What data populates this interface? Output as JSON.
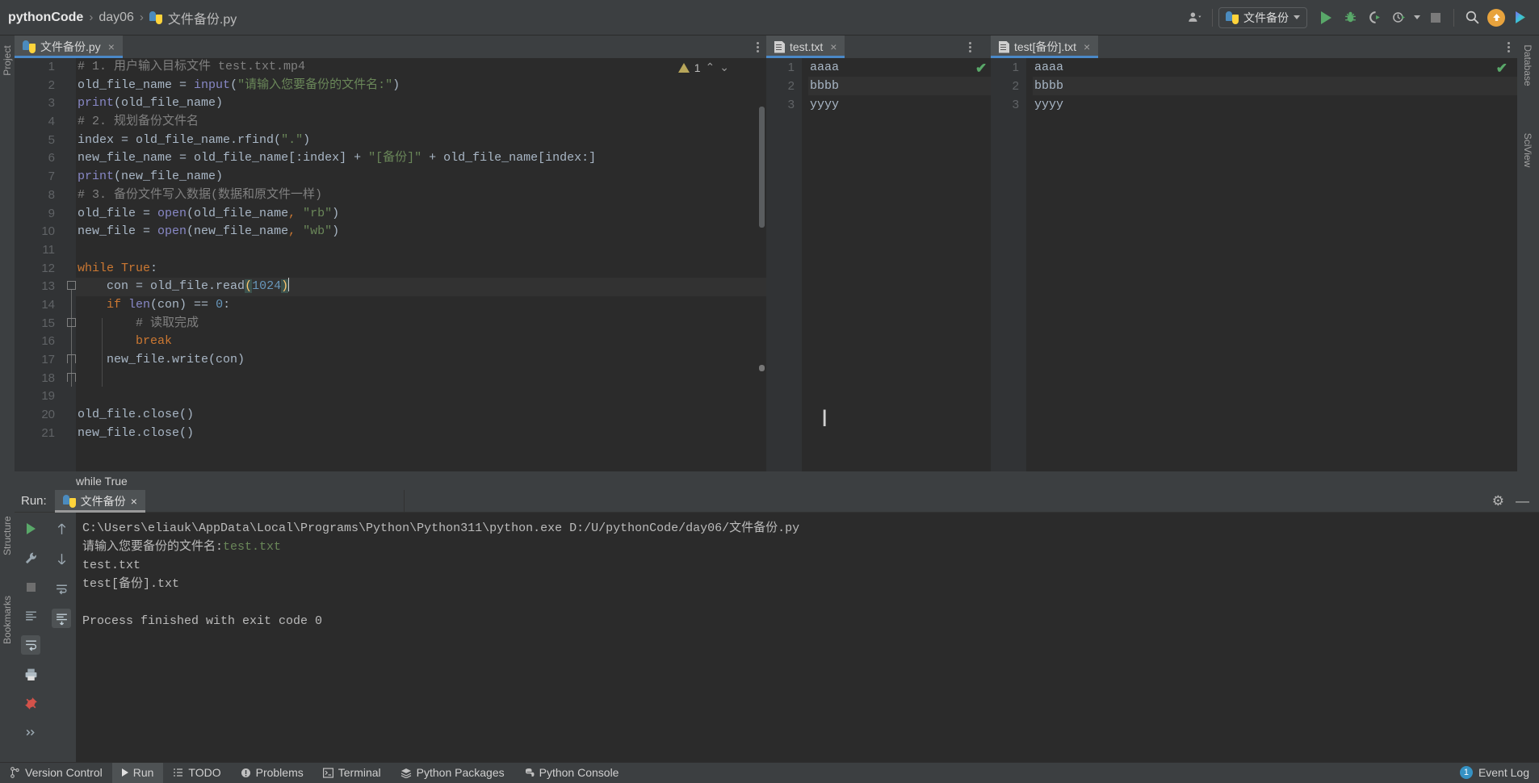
{
  "topbar": {
    "breadcrumbs": [
      {
        "label": "pythonCode",
        "icon": null
      },
      {
        "label": "day06",
        "icon": null
      },
      {
        "label": "文件备份.py",
        "icon": "python-file-icon"
      }
    ],
    "separator": "›",
    "account_icon": "account-icon",
    "run_config": {
      "label": "文件备份",
      "icon": "python-file-icon",
      "dropdown": "▾"
    },
    "actions": [
      {
        "name": "run-button",
        "icon": "play-icon",
        "label": "Run"
      },
      {
        "name": "debug-button",
        "icon": "bug-icon",
        "label": "Debug"
      },
      {
        "name": "run-with-coverage-button",
        "icon": "coverage-icon",
        "label": "Run with Coverage"
      },
      {
        "name": "profile-button",
        "icon": "profiler-icon",
        "label": "Profile"
      },
      {
        "name": "stop-button",
        "icon": "stop-icon",
        "label": "Stop"
      },
      {
        "name": "search-everywhere-button",
        "icon": "search-icon",
        "label": "Search Everywhere"
      },
      {
        "name": "update-project-button",
        "icon": "arrow-up-circle-icon",
        "label": "Update"
      },
      {
        "name": "ai-assistant-button",
        "icon": "ai-icon",
        "label": "AI Assistant"
      }
    ]
  },
  "editor": {
    "tab": {
      "label": "文件备份.py",
      "icon": "python-file-icon",
      "close": "×"
    },
    "options_icon": "more-options-icon",
    "inspection": {
      "warning_count": "1",
      "warn_icon": "warning-triangle-icon",
      "up": "⌃",
      "down": "⌄"
    },
    "breadcrumb_below": "while True",
    "lines": [
      {
        "n": "1",
        "tokens": [
          {
            "t": "# 1. 用户输入目标文件 test.txt.mp4",
            "c": "c-com"
          }
        ]
      },
      {
        "n": "2",
        "tokens": [
          {
            "t": "old_file_name ",
            "c": "c-var"
          },
          {
            "t": "= ",
            "c": "c-pun"
          },
          {
            "t": "input",
            "c": "c-fn"
          },
          {
            "t": "(",
            "c": "c-pun"
          },
          {
            "t": "\"请输入您要备份的文件名:\"",
            "c": "c-str"
          },
          {
            "t": ")",
            "c": "c-pun"
          }
        ]
      },
      {
        "n": "3",
        "tokens": [
          {
            "t": "print",
            "c": "c-fn"
          },
          {
            "t": "(old_file_name)",
            "c": "c-var"
          }
        ]
      },
      {
        "n": "4",
        "tokens": [
          {
            "t": "# 2. 规划备份文件名",
            "c": "c-com"
          }
        ]
      },
      {
        "n": "5",
        "tokens": [
          {
            "t": "index ",
            "c": "c-var"
          },
          {
            "t": "= ",
            "c": "c-pun"
          },
          {
            "t": "old_file_name.rfind(",
            "c": "c-var"
          },
          {
            "t": "\".\"",
            "c": "c-str"
          },
          {
            "t": ")",
            "c": "c-var"
          }
        ]
      },
      {
        "n": "6",
        "tokens": [
          {
            "t": "new_file_name ",
            "c": "c-var"
          },
          {
            "t": "= ",
            "c": "c-pun"
          },
          {
            "t": "old_file_name[:index] + ",
            "c": "c-var"
          },
          {
            "t": "\"[备份]\"",
            "c": "c-str"
          },
          {
            "t": " + old_file_name[index:]",
            "c": "c-var"
          }
        ]
      },
      {
        "n": "7",
        "tokens": [
          {
            "t": "print",
            "c": "c-fn"
          },
          {
            "t": "(new_file_name)",
            "c": "c-var"
          }
        ]
      },
      {
        "n": "8",
        "tokens": [
          {
            "t": "# 3. 备份文件写入数据(数据和原文件一样)",
            "c": "c-com"
          }
        ]
      },
      {
        "n": "9",
        "tokens": [
          {
            "t": "old_file ",
            "c": "c-var"
          },
          {
            "t": "= ",
            "c": "c-pun"
          },
          {
            "t": "open",
            "c": "c-fn"
          },
          {
            "t": "(old_file_name",
            "c": "c-var"
          },
          {
            "t": ", ",
            "c": "c-kw"
          },
          {
            "t": "\"rb\"",
            "c": "c-str"
          },
          {
            "t": ")",
            "c": "c-var"
          }
        ]
      },
      {
        "n": "10",
        "tokens": [
          {
            "t": "new_file ",
            "c": "c-var"
          },
          {
            "t": "= ",
            "c": "c-pun"
          },
          {
            "t": "open",
            "c": "c-fn"
          },
          {
            "t": "(new_file_name",
            "c": "c-var"
          },
          {
            "t": ", ",
            "c": "c-kw"
          },
          {
            "t": "\"wb\"",
            "c": "c-str"
          },
          {
            "t": ")",
            "c": "c-var"
          }
        ]
      },
      {
        "n": "11",
        "tokens": []
      },
      {
        "n": "12",
        "tokens": [
          {
            "t": "while ",
            "c": "c-kw"
          },
          {
            "t": "True",
            "c": "c-kw"
          },
          {
            "t": ":",
            "c": "c-pun"
          }
        ]
      },
      {
        "n": "13",
        "tokens": [
          {
            "t": "    con ",
            "c": "c-var"
          },
          {
            "t": "= ",
            "c": "c-pun"
          },
          {
            "t": "old_file.read",
            "c": "c-var"
          },
          {
            "t": "(",
            "c": "c-match"
          },
          {
            "t": "1024",
            "c": "c-num"
          },
          {
            "t": ")",
            "c": "c-match"
          }
        ],
        "highlight": true,
        "caret_after": true
      },
      {
        "n": "14",
        "tokens": [
          {
            "t": "    ",
            "c": "c-var"
          },
          {
            "t": "if ",
            "c": "c-kw"
          },
          {
            "t": "len",
            "c": "c-fn"
          },
          {
            "t": "(con) == ",
            "c": "c-var"
          },
          {
            "t": "0",
            "c": "c-num"
          },
          {
            "t": ":",
            "c": "c-pun"
          }
        ]
      },
      {
        "n": "15",
        "tokens": [
          {
            "t": "        # 读取完成",
            "c": "c-com"
          }
        ]
      },
      {
        "n": "16",
        "tokens": [
          {
            "t": "        ",
            "c": "c-var"
          },
          {
            "t": "break",
            "c": "c-kw"
          }
        ]
      },
      {
        "n": "17",
        "tokens": [
          {
            "t": "    new_file.write(con)",
            "c": "c-var"
          }
        ]
      },
      {
        "n": "18",
        "tokens": []
      },
      {
        "n": "19",
        "tokens": []
      },
      {
        "n": "20",
        "tokens": [
          {
            "t": "old_file.close()",
            "c": "c-var"
          }
        ]
      },
      {
        "n": "21",
        "tokens": [
          {
            "t": "new_file.close()",
            "c": "c-var"
          }
        ]
      }
    ]
  },
  "split_b": {
    "tab": {
      "label": "test.txt",
      "icon": "text-file-icon",
      "close": "×"
    },
    "options_icon": "more-options-icon",
    "status_icon": "checkmark-ok-icon",
    "lines": [
      {
        "n": "1",
        "text": "aaaa"
      },
      {
        "n": "2",
        "text": "bbbb"
      },
      {
        "n": "3",
        "text": "yyyy"
      }
    ]
  },
  "split_c": {
    "tab": {
      "label": "test[备份].txt",
      "icon": "text-file-icon",
      "close": "×"
    },
    "options_icon": "more-options-icon",
    "status_icon": "checkmark-ok-icon",
    "lines": [
      {
        "n": "1",
        "text": "aaaa"
      },
      {
        "n": "2",
        "text": "bbbb"
      },
      {
        "n": "3",
        "text": "yyyy"
      }
    ]
  },
  "run_panel": {
    "title": "Run:",
    "tab": {
      "label": "文件备份",
      "icon": "python-file-icon",
      "close": "×"
    },
    "settings_icon": "gear-icon",
    "hide_icon": "minimize-icon",
    "toolbar": [
      {
        "name": "rerun-button",
        "icon": "play-green-icon"
      },
      {
        "name": "wrench-button",
        "icon": "wrench-icon"
      },
      {
        "name": "stop-button",
        "icon": "stop-square-icon"
      },
      {
        "name": "scroll-to-end-button",
        "icon": "scroll-end-icon"
      },
      {
        "name": "print-button",
        "icon": "printer-icon"
      },
      {
        "name": "pin-button",
        "icon": "pin-icon"
      },
      {
        "name": "expand-button",
        "icon": "chevrons-icon"
      }
    ],
    "toolbar2": [
      {
        "name": "up-arrow-button",
        "icon": "arrow-up-icon"
      },
      {
        "name": "down-arrow-button",
        "icon": "arrow-down-icon"
      },
      {
        "name": "soft-wrap-button",
        "icon": "wrap-icon"
      },
      {
        "name": "scroll-end-toggle",
        "icon": "scroll-end-icon"
      }
    ],
    "output": [
      {
        "text": "C:\\Users\\eliauk\\AppData\\Local\\Programs\\Python\\Python311\\python.exe D:/U/pythonCode/day06/文件备份.py",
        "cls": ""
      },
      {
        "text": "请输入您要备份的文件名:",
        "cls": "",
        "suffix": "test.txt",
        "suffix_cls": "out-green"
      },
      {
        "text": "test.txt",
        "cls": ""
      },
      {
        "text": "test[备份].txt",
        "cls": ""
      },
      {
        "text": "",
        "cls": ""
      },
      {
        "text": "Process finished with exit code 0",
        "cls": ""
      }
    ]
  },
  "left_strip": [
    {
      "label": "Project",
      "name": "tool-window-project"
    },
    {
      "label": "Structure",
      "name": "tool-window-structure"
    },
    {
      "label": "Bookmarks",
      "name": "tool-window-bookmarks"
    }
  ],
  "right_strip": [
    {
      "label": "Database",
      "name": "tool-window-database"
    },
    {
      "label": "SciView",
      "name": "tool-window-sciview"
    }
  ],
  "statusbar": {
    "items": [
      {
        "label": "Version Control",
        "icon": "branch-icon",
        "name": "status-version-control",
        "active": false
      },
      {
        "label": "Run",
        "icon": "play-icon",
        "name": "status-run",
        "active": true
      },
      {
        "label": "TODO",
        "icon": "list-icon",
        "name": "status-todo",
        "active": false
      },
      {
        "label": "Problems",
        "icon": "error-icon",
        "name": "status-problems",
        "active": false
      },
      {
        "label": "Terminal",
        "icon": "terminal-icon",
        "name": "status-terminal",
        "active": false
      },
      {
        "label": "Python Packages",
        "icon": "packages-icon",
        "name": "status-python-packages",
        "active": false
      },
      {
        "label": "Python Console",
        "icon": "python-icon",
        "name": "status-python-console",
        "active": false
      }
    ],
    "event_log": {
      "count": "1",
      "label": "Event Log",
      "name": "status-event-log"
    }
  },
  "colors": {
    "accent_blue": "#4a88c7",
    "green": "#59a869",
    "comment_gray": "#808080",
    "keyword_orange": "#cc7832",
    "string_green": "#6a8759",
    "number_blue": "#6897bb",
    "bg_editor": "#2b2b2b",
    "bg_chrome": "#3c3f41"
  }
}
